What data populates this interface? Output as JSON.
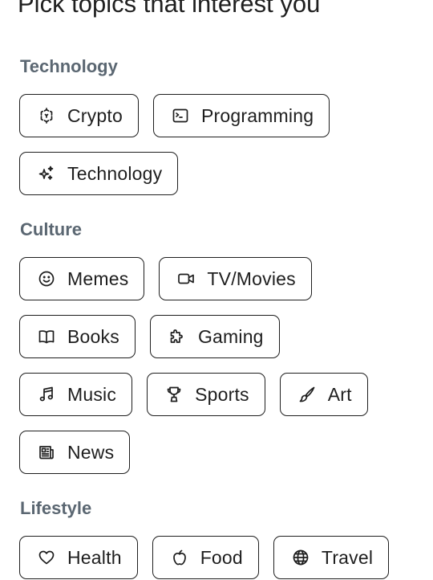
{
  "page": {
    "title": "Pick topics that interest you"
  },
  "sections": [
    {
      "heading": "Technology",
      "chips": [
        {
          "label": "Crypto",
          "icon": "crypto-icon"
        },
        {
          "label": "Programming",
          "icon": "terminal-icon"
        },
        {
          "label": "Technology",
          "icon": "sparkles-icon"
        }
      ]
    },
    {
      "heading": "Culture",
      "chips": [
        {
          "label": "Memes",
          "icon": "smiley-icon"
        },
        {
          "label": "TV/Movies",
          "icon": "video-camera-icon"
        },
        {
          "label": "Books",
          "icon": "open-book-icon"
        },
        {
          "label": "Gaming",
          "icon": "puzzle-piece-icon"
        },
        {
          "label": "Music",
          "icon": "music-note-icon"
        },
        {
          "label": "Sports",
          "icon": "trophy-icon"
        },
        {
          "label": "Art",
          "icon": "paint-brush-icon"
        },
        {
          "label": "News",
          "icon": "newspaper-icon"
        }
      ]
    },
    {
      "heading": "Lifestyle",
      "chips": [
        {
          "label": "Health",
          "icon": "heart-icon"
        },
        {
          "label": "Food",
          "icon": "apple-icon"
        },
        {
          "label": "Travel",
          "icon": "globe-icon"
        }
      ]
    }
  ]
}
